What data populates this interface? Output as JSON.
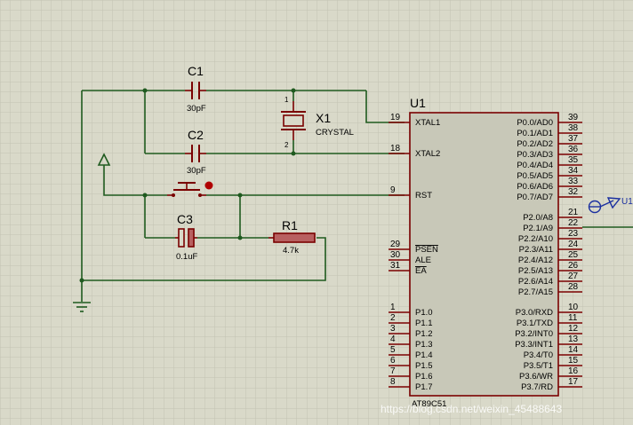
{
  "chip": {
    "ref": "U1",
    "part": "AT89C51",
    "left_pins": [
      {
        "num": "19",
        "name": "XTAL1"
      },
      {
        "num": "18",
        "name": "XTAL2"
      },
      {
        "num": "9",
        "name": "RST"
      },
      {
        "num": "29",
        "name": "PSEN",
        "overline": true
      },
      {
        "num": "30",
        "name": "ALE"
      },
      {
        "num": "31",
        "name": "EA",
        "overline": true
      },
      {
        "num": "1",
        "name": "P1.0"
      },
      {
        "num": "2",
        "name": "P1.1"
      },
      {
        "num": "3",
        "name": "P1.2"
      },
      {
        "num": "4",
        "name": "P1.3"
      },
      {
        "num": "5",
        "name": "P1.4"
      },
      {
        "num": "6",
        "name": "P1.5"
      },
      {
        "num": "7",
        "name": "P1.6"
      },
      {
        "num": "8",
        "name": "P1.7"
      }
    ],
    "right_pins": [
      {
        "num": "39",
        "name": "P0.0/AD0"
      },
      {
        "num": "38",
        "name": "P0.1/AD1"
      },
      {
        "num": "37",
        "name": "P0.2/AD2"
      },
      {
        "num": "36",
        "name": "P0.3/AD3"
      },
      {
        "num": "35",
        "name": "P0.4/AD4"
      },
      {
        "num": "34",
        "name": "P0.5/AD5"
      },
      {
        "num": "33",
        "name": "P0.6/AD6"
      },
      {
        "num": "32",
        "name": "P0.7/AD7"
      },
      {
        "num": "21",
        "name": "P2.0/A8"
      },
      {
        "num": "22",
        "name": "P2.1/A9"
      },
      {
        "num": "23",
        "name": "P2.2/A10"
      },
      {
        "num": "24",
        "name": "P2.3/A11"
      },
      {
        "num": "25",
        "name": "P2.4/A12"
      },
      {
        "num": "26",
        "name": "P2.5/A13"
      },
      {
        "num": "27",
        "name": "P2.6/A14"
      },
      {
        "num": "28",
        "name": "P2.7/A15"
      },
      {
        "num": "10",
        "name": "P3.0/RXD"
      },
      {
        "num": "11",
        "name": "P3.1/TXD"
      },
      {
        "num": "12",
        "name": "P3.2/INT0"
      },
      {
        "num": "13",
        "name": "P3.3/INT1"
      },
      {
        "num": "14",
        "name": "P3.4/T0"
      },
      {
        "num": "15",
        "name": "P3.5/T1"
      },
      {
        "num": "16",
        "name": "P3.6/WR"
      },
      {
        "num": "17",
        "name": "P3.7/RD"
      }
    ]
  },
  "components": {
    "c1": {
      "ref": "C1",
      "value": "30pF"
    },
    "c2": {
      "ref": "C2",
      "value": "30pF"
    },
    "c3": {
      "ref": "C3",
      "value": "0.1uF"
    },
    "x1": {
      "ref": "X1",
      "value": "CRYSTAL",
      "pin1": "1",
      "pin2": "2"
    },
    "r1": {
      "ref": "R1",
      "value": "4.7k"
    }
  },
  "offpage_label": "U1",
  "watermark": "https://blog.csdn.net/weixin_45488643",
  "colors": {
    "background": "#d9d9c9",
    "grid": "#c4c4b4",
    "wire": "#1f5a1f",
    "component": "#7a0000",
    "chip_fill": "#c8c8b8",
    "junction": "#1f5a1f"
  }
}
